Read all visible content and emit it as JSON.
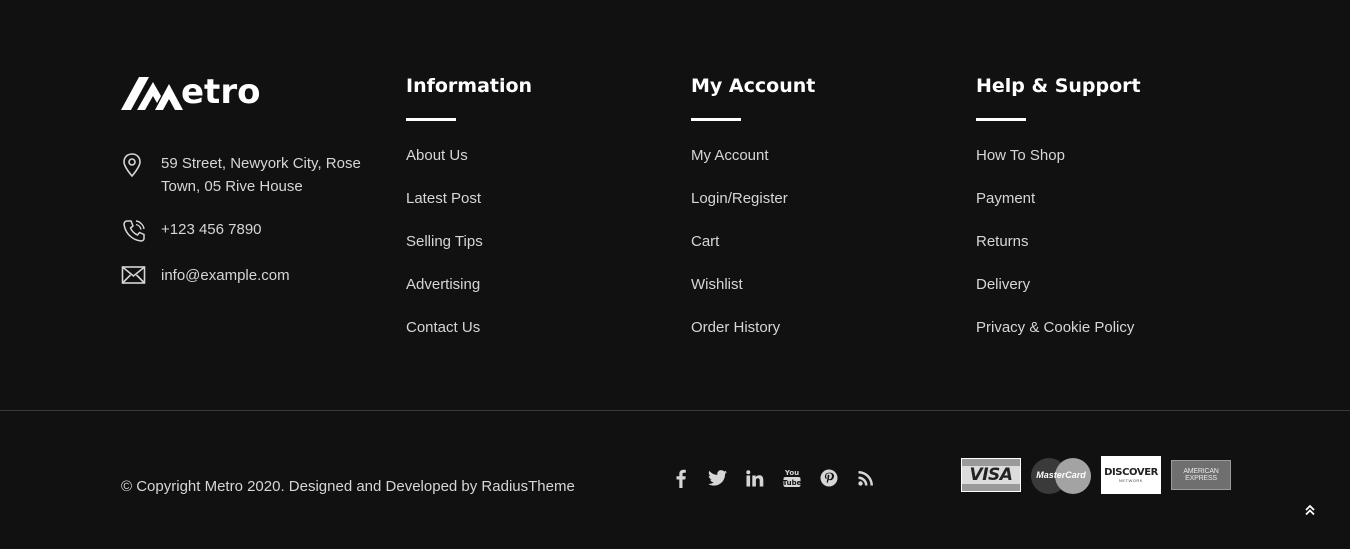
{
  "brand": {
    "logo_text": "etro",
    "address": "59 Street, Newyork City, Rose Town, 05 Rive House",
    "phone": "+123 456 7890",
    "email": "info@example.com"
  },
  "columns": [
    {
      "title": "Information",
      "links": [
        "About Us",
        "Latest Post",
        "Selling Tips",
        "Advertising",
        "Contact Us"
      ]
    },
    {
      "title": "My Account",
      "links": [
        "My Account",
        "Login/Register",
        "Cart",
        "Wishlist",
        "Order History"
      ]
    },
    {
      "title": "Help & Support",
      "links": [
        "How To Shop",
        "Payment",
        "Returns",
        "Delivery",
        "Privacy & Cookie Policy"
      ]
    }
  ],
  "footer": {
    "copyright": "© Copyright Metro 2020. Designed and Developed by RadiusTheme",
    "social_icons": [
      "facebook-icon",
      "twitter-icon",
      "linkedin-icon",
      "youtube-icon",
      "pinterest-icon",
      "rss-icon"
    ],
    "payment_cards": {
      "visa": "VISA",
      "mastercard": "MasterCard",
      "discover": "DISCOVER",
      "discover_sub": "NETWORK",
      "amex_line1": "AMERICAN",
      "amex_line2": "EXPRESS"
    }
  },
  "colors": {
    "background": "#111111",
    "text": "#d6d6d6",
    "heading": "#ffffff",
    "divider": "#3a3a3a"
  }
}
